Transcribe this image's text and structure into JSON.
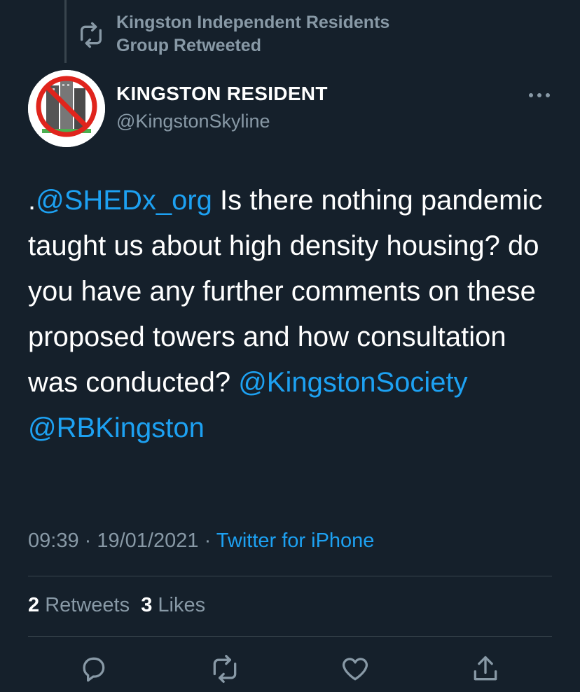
{
  "retweet_banner": {
    "text": "Kingston Independent Residents Group Retweeted",
    "icon": "retweet-icon"
  },
  "author": {
    "display_name": "KINGSTON RESIDENT",
    "handle": "@KingstonSkyline",
    "avatar_icon": "no-towers-logo"
  },
  "more_icon": "more-horizontal-icon",
  "tweet": {
    "prefix": ".",
    "mention1": "@SHEDx_org",
    "body": " Is there nothing pandemic taught us about high density housing? do you have any further comments on these proposed towers and how consultation was conducted? ",
    "mention2": "@KingstonSociety",
    "mention3": "@RBKingston"
  },
  "meta": {
    "time": "09:39",
    "sep1": " · ",
    "date": "19/01/2021",
    "sep2": " · ",
    "source": "Twitter for iPhone"
  },
  "stats": {
    "retweets_count": "2",
    "retweets_label": "Retweets",
    "likes_count": "3",
    "likes_label": "Likes"
  },
  "actions": [
    "reply-icon",
    "retweet-icon",
    "like-icon",
    "share-icon"
  ],
  "colors": {
    "background": "#15202b",
    "link": "#1da1f2",
    "secondary": "#8899a6",
    "divider": "#38444d"
  }
}
